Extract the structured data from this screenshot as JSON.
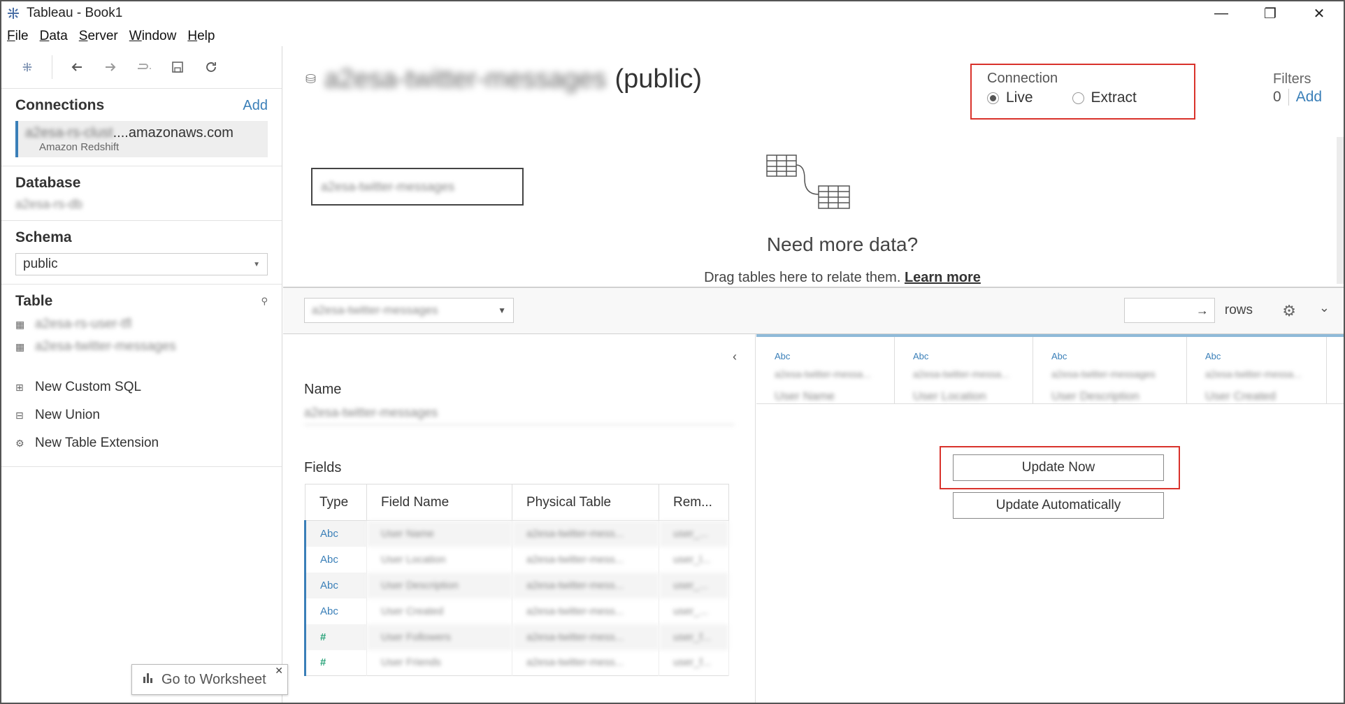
{
  "window": {
    "title": "Tableau - Book1",
    "minimize": "—",
    "restore": "❐",
    "close": "✕"
  },
  "menu": [
    "File",
    "Data",
    "Server",
    "Window",
    "Help"
  ],
  "sidebar": {
    "connections_label": "Connections",
    "add_label": "Add",
    "connection_host_blur": "a2esa-rs-clust",
    "connection_host_suffix": "....amazonaws.com",
    "connection_type": "Amazon Redshift",
    "database_label": "Database",
    "database_value": "a2esa-rs-db",
    "schema_label": "Schema",
    "schema_value": "public",
    "table_label": "Table",
    "tables": [
      "a2esa-rs-user-tfl",
      "a2esa-twitter-messages"
    ],
    "new_custom_sql": "New Custom SQL",
    "new_union": "New Union",
    "new_table_extension": "New Table Extension",
    "go_to_worksheet": "Go to Worksheet"
  },
  "datasource": {
    "name_blur": "a2esa-twitter-messages",
    "schema_suffix": "(public)",
    "connection_label": "Connection",
    "live_label": "Live",
    "extract_label": "Extract",
    "selected_connection": "Live",
    "filters_label": "Filters",
    "filters_count": "0",
    "filters_add": "Add",
    "canvas_table": "a2esa-twitter-messages",
    "need_more": "Need more data?",
    "drag_hint": "Drag tables here to relate them.",
    "learn_more": "Learn more"
  },
  "grid_bar": {
    "table_select": "a2esa-twitter-messages",
    "rows_label": "rows",
    "rows_arrow": "→"
  },
  "meta": {
    "collapse": "‹",
    "name_label": "Name",
    "name_value": "a2esa-twitter-messages",
    "fields_label": "Fields",
    "columns": [
      "Type",
      "Field Name",
      "Physical Table",
      "Rem..."
    ],
    "rows": [
      {
        "type": "Abc",
        "field": "User Name",
        "table": "a2esa-twitter-mess...",
        "remote": "user_..."
      },
      {
        "type": "Abc",
        "field": "User Location",
        "table": "a2esa-twitter-mess...",
        "remote": "user_l..."
      },
      {
        "type": "Abc",
        "field": "User Description",
        "table": "a2esa-twitter-mess...",
        "remote": "user_..."
      },
      {
        "type": "Abc",
        "field": "User Created",
        "table": "a2esa-twitter-mess...",
        "remote": "user_..."
      },
      {
        "type": "#",
        "field": "User Followers",
        "table": "a2esa-twitter-mess...",
        "remote": "user_f..."
      },
      {
        "type": "#",
        "field": "User Friends",
        "table": "a2esa-twitter-mess...",
        "remote": "user_f..."
      }
    ]
  },
  "data_grid": {
    "columns": [
      {
        "type": "Abc",
        "source": "a2esa-twitter-messa...",
        "name": "User Name"
      },
      {
        "type": "Abc",
        "source": "a2esa-twitter-messa...",
        "name": "User Location"
      },
      {
        "type": "Abc",
        "source": "a2esa-twitter-messages",
        "name": "User Description"
      },
      {
        "type": "Abc",
        "source": "a2esa-twitter-messa...",
        "name": "User Created"
      }
    ],
    "update_now": "Update Now",
    "update_automatically": "Update Automatically"
  },
  "colors": {
    "accent": "#3a7fb8",
    "highlight": "#d9322b",
    "number_type": "#2aa37a"
  }
}
